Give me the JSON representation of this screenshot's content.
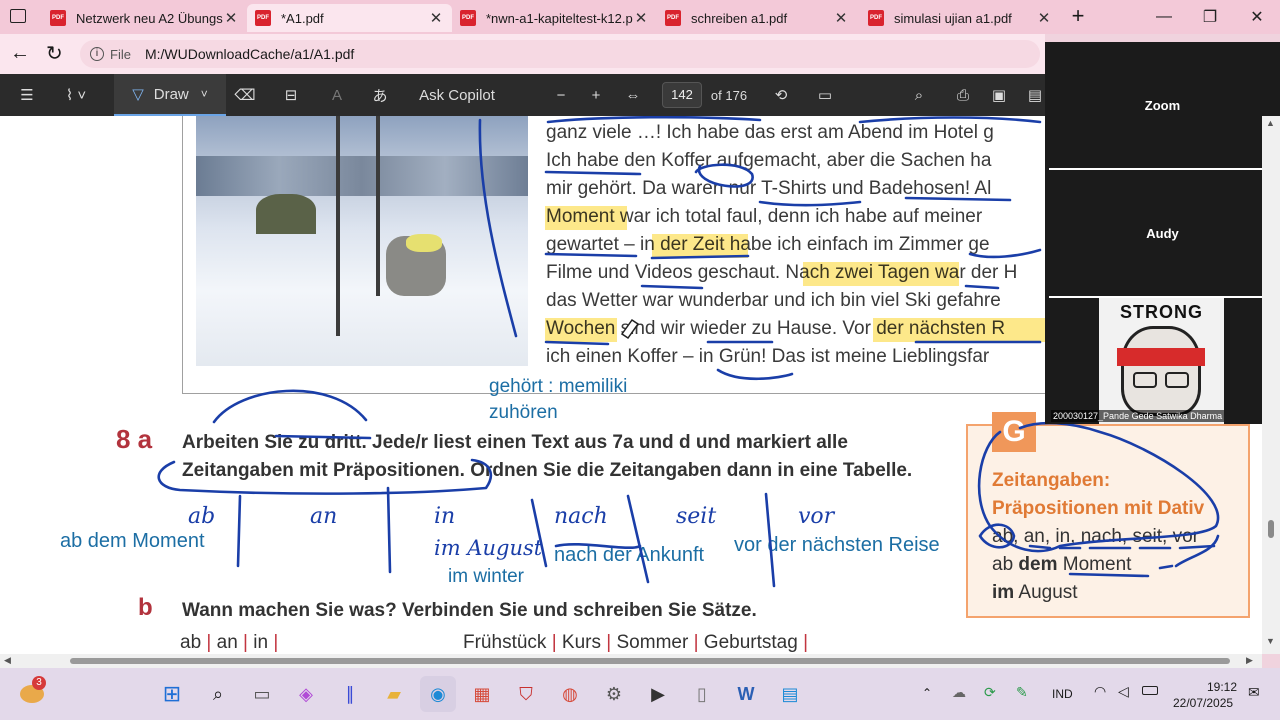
{
  "browser": {
    "tabs": [
      {
        "label": "Netzwerk neu A2 Übungsb"
      },
      {
        "label": "*A1.pdf"
      },
      {
        "label": "*nwn-a1-kapiteltest-k12.p"
      },
      {
        "label": "schreiben a1.pdf"
      },
      {
        "label": "simulasi ujian a1.pdf"
      }
    ],
    "address_label": "File",
    "address_value": "M:/WUDownloadCache/a1/A1.pdf"
  },
  "toolbar": {
    "draw_label": "Draw",
    "copilot_label": "Ask Copilot",
    "page_value": "142",
    "page_total": "of 176"
  },
  "document": {
    "reading_lines": [
      "ganz viele …! Ich habe das erst am Abend im Hotel g",
      "Ich habe den Koffer aufgemacht, aber die Sachen ha",
      "mir gehört. Da waren nur T-Shirts und Badehosen! Al",
      "Moment war ich total faul, denn ich habe auf meiner",
      "gewartet – in der Zeit habe ich einfach im Zimmer ge",
      "Filme und Videos geschaut. Nach zwei Tagen war der H",
      "das Wetter war wunderbar und ich bin viel Ski gefahre",
      "Wochen sind wir wieder zu Hause. Vor der nächsten R",
      "ich einen Koffer – in Grün! Das ist meine Lieblingsfar"
    ],
    "note_1": "gehört : memiliki",
    "note_2": "zuhören",
    "ex8_number": "8 a",
    "ex8_line1": "Arbeiten Sie zu dritt. Jede/r liest einen Text aus 7a und d und markiert alle",
    "ex8_line2": "Zeitangaben mit Präpositionen. Ordnen Sie die Zeitangaben dann in eine Tabelle.",
    "prep_headers": [
      "ab",
      "an",
      "in",
      "nach",
      "seit",
      "vor"
    ],
    "typed_entries": {
      "ab": "ab dem Moment",
      "in_winter": "im winter",
      "nach": "nach der Ankunft",
      "vor": "vor der nächsten Reise"
    },
    "handwritten_in": "im August",
    "ex_b_letter": "b",
    "ex_b_text": "Wann machen Sie was? Verbinden Sie und schreiben Sie Sätze.",
    "bottom_words_left": [
      "ab",
      "an",
      "in"
    ],
    "bottom_words_right": [
      "Frühstück",
      "Kurs",
      "Sommer",
      "Geburtstag"
    ],
    "grammar_box": {
      "letter": "G",
      "title_1": "Zeitangaben:",
      "title_2": "Präpositionen mit Dativ",
      "list": "ab, an, in, nach, seit, vor",
      "example_1_pre": "ab",
      "example_1_bold": "dem",
      "example_1_post": "Moment",
      "example_2_bold": "im",
      "example_2_post": "August"
    }
  },
  "video_panel": {
    "tiles": [
      {
        "name": "Zoom"
      },
      {
        "name": "Audy"
      }
    ],
    "participant_label": "200030127_Pande Gede Satwika Dharma",
    "participant_logo_text": "STRONG"
  },
  "taskbar": {
    "weather_badge": "3",
    "language": "IND",
    "time": "19:12",
    "date": "22/07/2025"
  }
}
